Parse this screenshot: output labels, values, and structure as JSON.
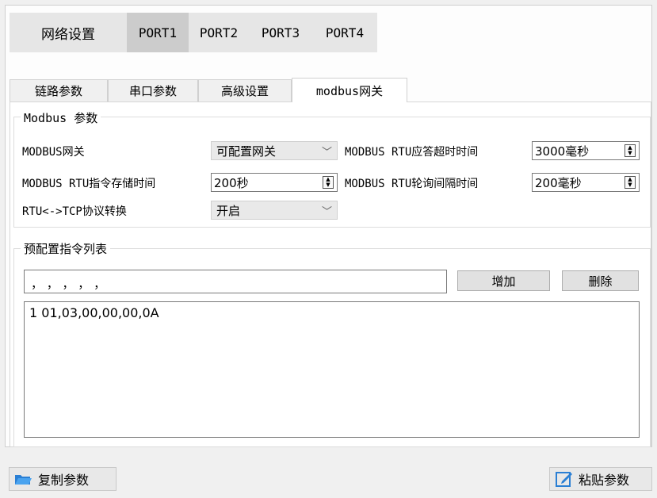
{
  "top_tabs": [
    "网络设置",
    "PORT1",
    "PORT2",
    "PORT3",
    "PORT4"
  ],
  "sub_tabs": [
    "链路参数",
    "串口参数",
    "高级设置",
    "modbus网关"
  ],
  "modbus_group": {
    "title": "Modbus 参数",
    "gateway_label": "MODBUS网关",
    "gateway_value": "可配置网关",
    "timeout_label": "MODBUS RTU应答超时时间",
    "timeout_value": "3000毫秒",
    "storage_label": "MODBUS RTU指令存储时间",
    "storage_value": "200秒",
    "interval_label": "MODBUS RTU轮询间隔时间",
    "interval_value": "200毫秒",
    "protocol_label": "RTU<->TCP协议转换",
    "protocol_value": "开启"
  },
  "preconfig_group": {
    "title": "预配置指令列表",
    "input_value": "，  ，  ，  ，  ，",
    "add_label": "增加",
    "delete_label": "删除",
    "list_items": [
      "1 01,03,00,00,00,0A"
    ]
  },
  "bottom": {
    "copy_label": "复制参数",
    "paste_label": "粘贴参数"
  },
  "colors": {
    "folder_icon": "#2a7fd4",
    "selected_tab": "#cccccc"
  },
  "icons": {
    "copy": "folder-icon",
    "paste": "edit-icon",
    "spin": "spin-arrows-icon",
    "combo": "chevron-down-icon"
  }
}
